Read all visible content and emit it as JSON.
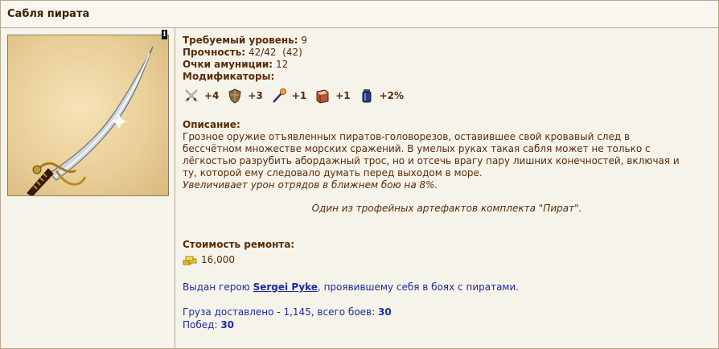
{
  "window": {
    "title": "Сабля пирата"
  },
  "item": {
    "info_badge": "i",
    "required_level_label": "Требуемый уровень:",
    "required_level_value": "9",
    "durability_label": "Прочность:",
    "durability_value": "42/42  (42)",
    "ammo_points_label": "Очки амуниции:",
    "ammo_points_value": "12",
    "modifiers_label": "Модификаторы:",
    "modifiers": [
      {
        "icon": "crossed-swords-icon",
        "value": "+4"
      },
      {
        "icon": "shield-icon",
        "value": "+3"
      },
      {
        "icon": "magic-wand-icon",
        "value": "+1"
      },
      {
        "icon": "spellbook-icon",
        "value": "+1"
      },
      {
        "icon": "potion-jar-icon",
        "value": "+2%"
      }
    ],
    "description_label": "Описание:",
    "description_text": "Грозное оружие отъявленных пиратов-головорезов, оставившее свой кровавый след в бессчётном множестве морских сражений. В умелых руках такая сабля может не только с лёгкостью разрубить абордажный трос, но и отсечь врагу пару лишних конечностей, включая и ту, которой ему следовало думать перед выходом в море.",
    "effect_text": "Увеличивает урон отрядов в ближнем бою на 8%.",
    "set_note": "Один из трофейных артефактов комплекта \"Пират\".",
    "repair_cost_label": "Стоимость ремонта:",
    "repair_cost_value": "16,000",
    "issued_prefix": "Выдан герою ",
    "hero_name": "Sergei Pyke",
    "issued_suffix": ", проявившему себя в боях с пиратами.",
    "cargo_prefix": "Груза доставлено - 1,145, всего боев: ",
    "battles_value": "30",
    "wins_label": "Побед: ",
    "wins_value": "30"
  },
  "colors": {
    "text_brown": "#592c08",
    "link_blue": "#1c2a9e",
    "border": "#b7a98e",
    "background": "#f6f3ea"
  }
}
